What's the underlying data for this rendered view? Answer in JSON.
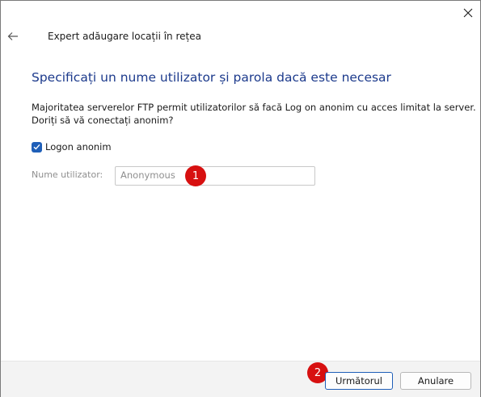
{
  "wizard": {
    "title": "Expert adăugare locații în rețea",
    "heading": "Specificați un nume utilizator și parola dacă este necesar",
    "description_lines": [
      "Majoritatea serverelor FTP permit utilizatorilor să facă Log on anonim cu acces limitat la server.",
      "Doriți să vă conectați anonim?"
    ],
    "anonymous_checkbox": {
      "label": "Logon anonim",
      "checked": true
    },
    "username": {
      "label": "Nume utilizator:",
      "value": "Anonymous",
      "disabled": true
    }
  },
  "buttons": {
    "next": "Următorul",
    "cancel": "Anulare"
  },
  "callouts": [
    "1",
    "2"
  ],
  "icons": {
    "close": "close-icon",
    "back": "back-arrow-icon",
    "check": "checkmark-icon"
  },
  "colors": {
    "heading": "#1c3a8c",
    "accent": "#1f5fb8",
    "callout": "#d71010"
  }
}
